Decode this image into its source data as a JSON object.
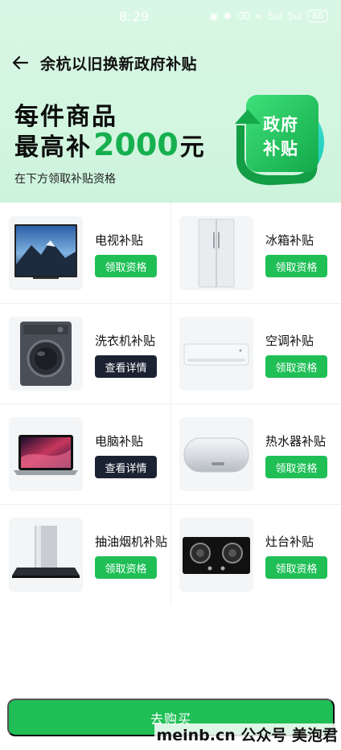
{
  "status_bar": {
    "time": "8:29",
    "signal_1": "5ul",
    "signal_2": "5ul",
    "battery": "86"
  },
  "header": {
    "title": "余杭以旧换新政府补贴"
  },
  "promo": {
    "line1": "每件商品",
    "line2_prefix": "最高补",
    "amount": "2000",
    "line2_suffix": "元",
    "subtitle": "在下方领取补贴资格",
    "badge_line1": "政府",
    "badge_line2": "补贴"
  },
  "items": [
    {
      "label": "电视补贴",
      "button": "领取资格",
      "icon": "tv-icon",
      "style": "green"
    },
    {
      "label": "冰箱补贴",
      "button": "领取资格",
      "icon": "fridge-icon",
      "style": "green"
    },
    {
      "label": "洗衣机补贴",
      "button": "查看详情",
      "icon": "washing-machine-icon",
      "style": "dark"
    },
    {
      "label": "空调补贴",
      "button": "领取资格",
      "icon": "air-conditioner-icon",
      "style": "green"
    },
    {
      "label": "电脑补贴",
      "button": "查看详情",
      "icon": "laptop-icon",
      "style": "dark"
    },
    {
      "label": "热水器补贴",
      "button": "领取资格",
      "icon": "water-heater-icon",
      "style": "green"
    },
    {
      "label": "抽油烟机补贴",
      "button": "领取资格",
      "icon": "range-hood-icon",
      "style": "green"
    },
    {
      "label": "灶台补贴",
      "button": "领取资格",
      "icon": "gas-stove-icon",
      "style": "green"
    }
  ],
  "footer": {
    "buy_label": "去购买",
    "watermark": "meinb.cn  公众号 美泡君"
  },
  "colors": {
    "accent_green": "#1fbf56",
    "dark_button": "#1b2333",
    "hero_bg": "#d6f6e2"
  }
}
